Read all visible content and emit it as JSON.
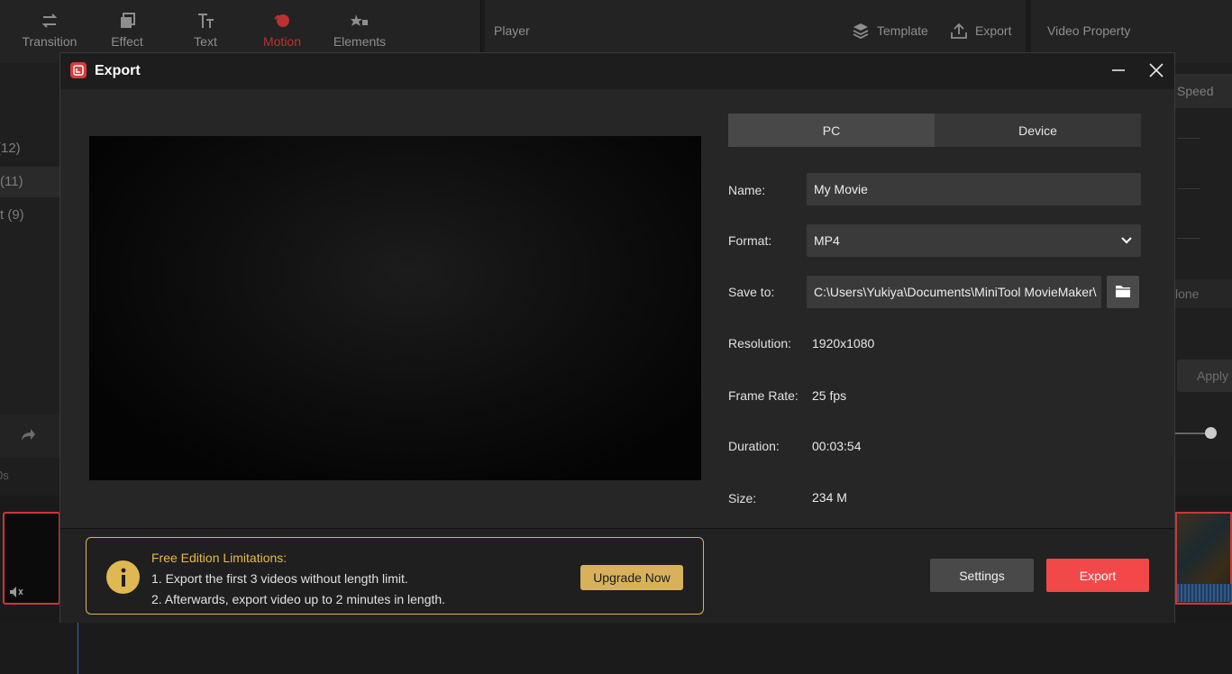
{
  "background": {
    "toolbar": [
      {
        "label": "Transition",
        "icon": "transition-icon"
      },
      {
        "label": "Effect",
        "icon": "effect-icon"
      },
      {
        "label": "Text",
        "icon": "text-icon"
      },
      {
        "label": "Motion",
        "icon": "motion-icon",
        "active": true
      },
      {
        "label": "Elements",
        "icon": "elements-icon"
      }
    ],
    "player_title": "Player",
    "template_label": "Template",
    "export_label": "Export",
    "property_title": "Video Property",
    "left_items": [
      "(12)",
      "(11)",
      "t (9)"
    ],
    "speed_label": "Speed",
    "none_label": "lone",
    "apply_label": "Apply",
    "ruler_label": "0s"
  },
  "dialog": {
    "title": "Export",
    "tabs": [
      {
        "label": "PC",
        "active": true
      },
      {
        "label": "Device",
        "active": false
      }
    ],
    "name_label": "Name:",
    "name_value": "My Movie",
    "format_label": "Format:",
    "format_value": "MP4",
    "save_label": "Save to:",
    "save_value": "C:\\Users\\Yukiya\\Documents\\MiniTool MovieMaker\\",
    "resolution_label": "Resolution:",
    "resolution_value": "1920x1080",
    "framerate_label": "Frame Rate:",
    "framerate_value": "25 fps",
    "duration_label": "Duration:",
    "duration_value": "00:03:54",
    "size_label": "Size:",
    "size_value": "234 M",
    "notice": {
      "title": "Free Edition Limitations:",
      "line1": "1. Export the first 3 videos without length limit.",
      "line2": "2. Afterwards, export video up to 2 minutes in length.",
      "upgrade_label": "Upgrade Now"
    },
    "settings_label": "Settings",
    "export_label": "Export"
  },
  "colors": {
    "accent_red": "#f2484a",
    "gold": "#d7b25a",
    "active_motion": "#b9322f"
  }
}
